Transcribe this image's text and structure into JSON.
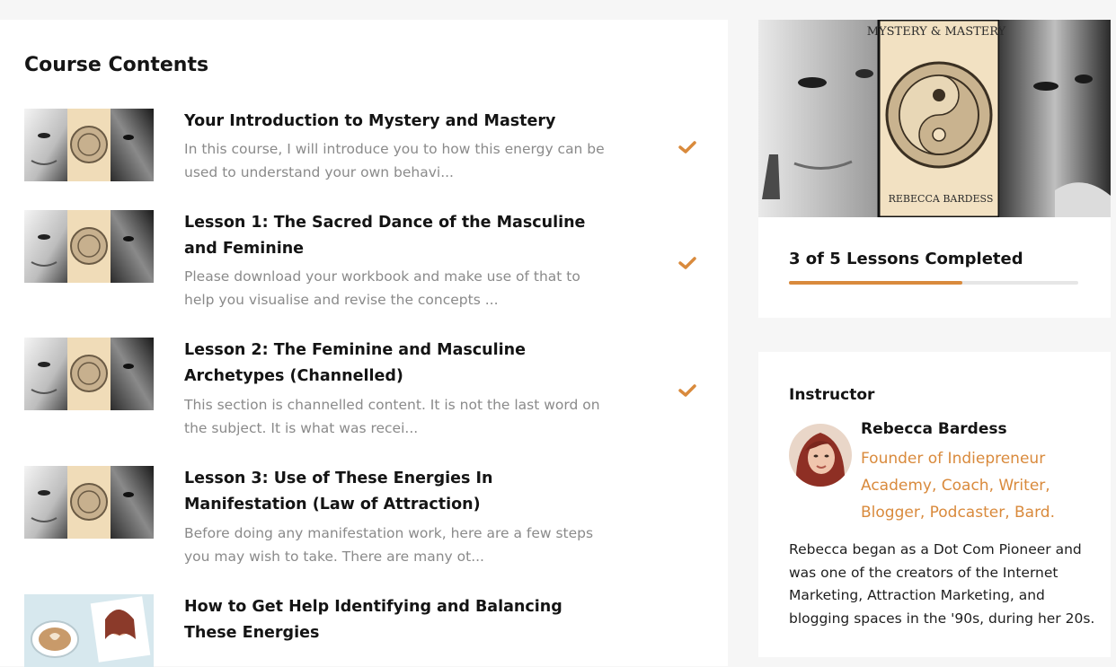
{
  "course": {
    "section_title": "Course Contents",
    "lessons": [
      {
        "title": "Your Introduction to Mystery and Mastery",
        "description": "In this course, I will introduce you to how this energy can be used to understand your own behavi...",
        "completed": true,
        "thumbnail": "mystery-mastery-thumbnail"
      },
      {
        "title": "Lesson 1: The Sacred Dance of the Masculine and Feminine",
        "description": "Please download your workbook and make use of that to help you visualise and revise the concepts ...",
        "completed": true,
        "thumbnail": "mystery-mastery-thumbnail"
      },
      {
        "title": "Lesson 2: The Feminine and Masculine Archetypes (Channelled)",
        "description": "This section is channelled content. It is not the last word on the subject. It is what was recei...",
        "completed": true,
        "thumbnail": "mystery-mastery-thumbnail"
      },
      {
        "title": "Lesson 3: Use of These Energies In Manifestation (Law of Attraction)",
        "description": "Before doing any manifestation work, here are a few steps you may wish to take. There are many ot...",
        "completed": false,
        "thumbnail": "mystery-mastery-thumbnail"
      },
      {
        "title": "How to Get Help Identifying and Balancing These Energies",
        "description": "",
        "completed": false,
        "thumbnail": "coffee-and-instructor-thumbnail"
      }
    ]
  },
  "sidebar": {
    "cover": {
      "title": "MYSTERY & MASTERY",
      "author": "REBECCA BARDESS"
    },
    "progress": {
      "label": "3 of 5 Lessons Completed",
      "completed": 3,
      "total": 5
    },
    "instructor": {
      "heading": "Instructor",
      "name": "Rebecca Bardess",
      "role": "Founder of Indiepreneur Academy, Coach, Writer, Blogger, Podcaster, Bard.",
      "bio": "Rebecca began as a Dot Com Pioneer and was one of the creators of the Internet Marketing, Attraction Marketing, and blogging spaces in the '90s, during her 20s."
    }
  },
  "colors": {
    "accent": "#d98a3c",
    "title_text": "#141414",
    "muted_text": "#8a8a8a",
    "page_background": "#f6f6f6",
    "card_background": "#ffffff"
  }
}
